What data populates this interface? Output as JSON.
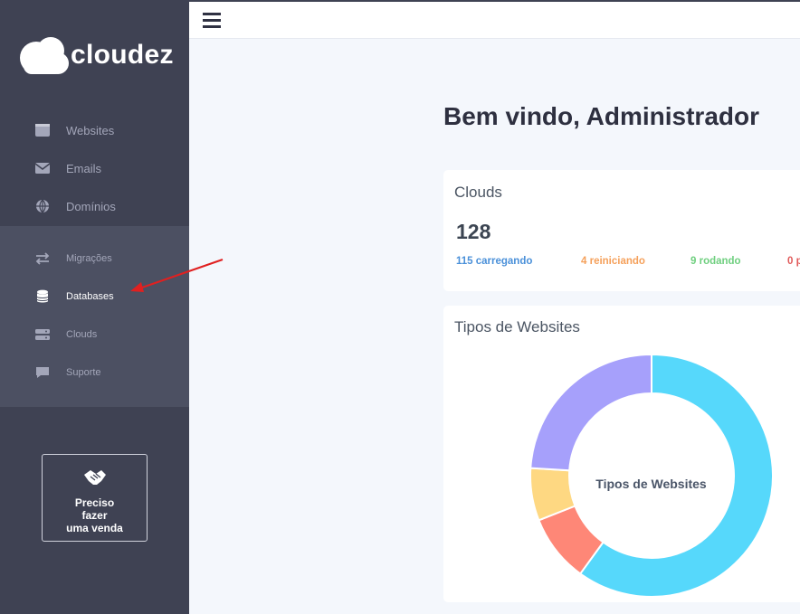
{
  "brand": {
    "name": "cloudez"
  },
  "sidebar": {
    "items": [
      {
        "label": "Websites",
        "icon": "browser-icon"
      },
      {
        "label": "Emails",
        "icon": "envelope-icon"
      },
      {
        "label": "Domínios",
        "icon": "globe-icon"
      },
      {
        "label": "Migrações",
        "icon": "exchange-icon"
      },
      {
        "label": "Databases",
        "icon": "database-icon",
        "active": true
      },
      {
        "label": "Clouds",
        "icon": "server-icon"
      },
      {
        "label": "Suporte",
        "icon": "comment-icon"
      }
    ],
    "sale_button": {
      "line1": "Preciso",
      "line2": "fazer",
      "line3": "uma venda",
      "icon": "handshake-icon"
    }
  },
  "main": {
    "welcome": "Bem vindo, Administrador",
    "clouds_card": {
      "title": "Clouds",
      "total": "128",
      "stats": [
        {
          "label": "115 carregando",
          "color": "#4a90d9"
        },
        {
          "label": "4 reiniciando",
          "color": "#f5a05a"
        },
        {
          "label": "9 rodando",
          "color": "#6fcf7f"
        },
        {
          "label": "0 p",
          "color": "#e05a5a"
        }
      ]
    },
    "websites_card": {
      "title": "Tipos de Websites",
      "center_label": "Tipos de Websites"
    }
  },
  "chart_data": {
    "type": "pie",
    "title": "Tipos de Websites",
    "slices": [
      {
        "value": 60,
        "color": "#56d8fb"
      },
      {
        "value": 9,
        "color": "#fe8777"
      },
      {
        "value": 7,
        "color": "#fed882"
      },
      {
        "value": 24,
        "color": "#a6a0fb"
      }
    ]
  },
  "colors": {
    "sidebar_bg": "#3f4253",
    "sidebar_group_bg": "#4c5062",
    "page_bg": "#f4f7fc",
    "annotation_arrow": "#e02020"
  }
}
